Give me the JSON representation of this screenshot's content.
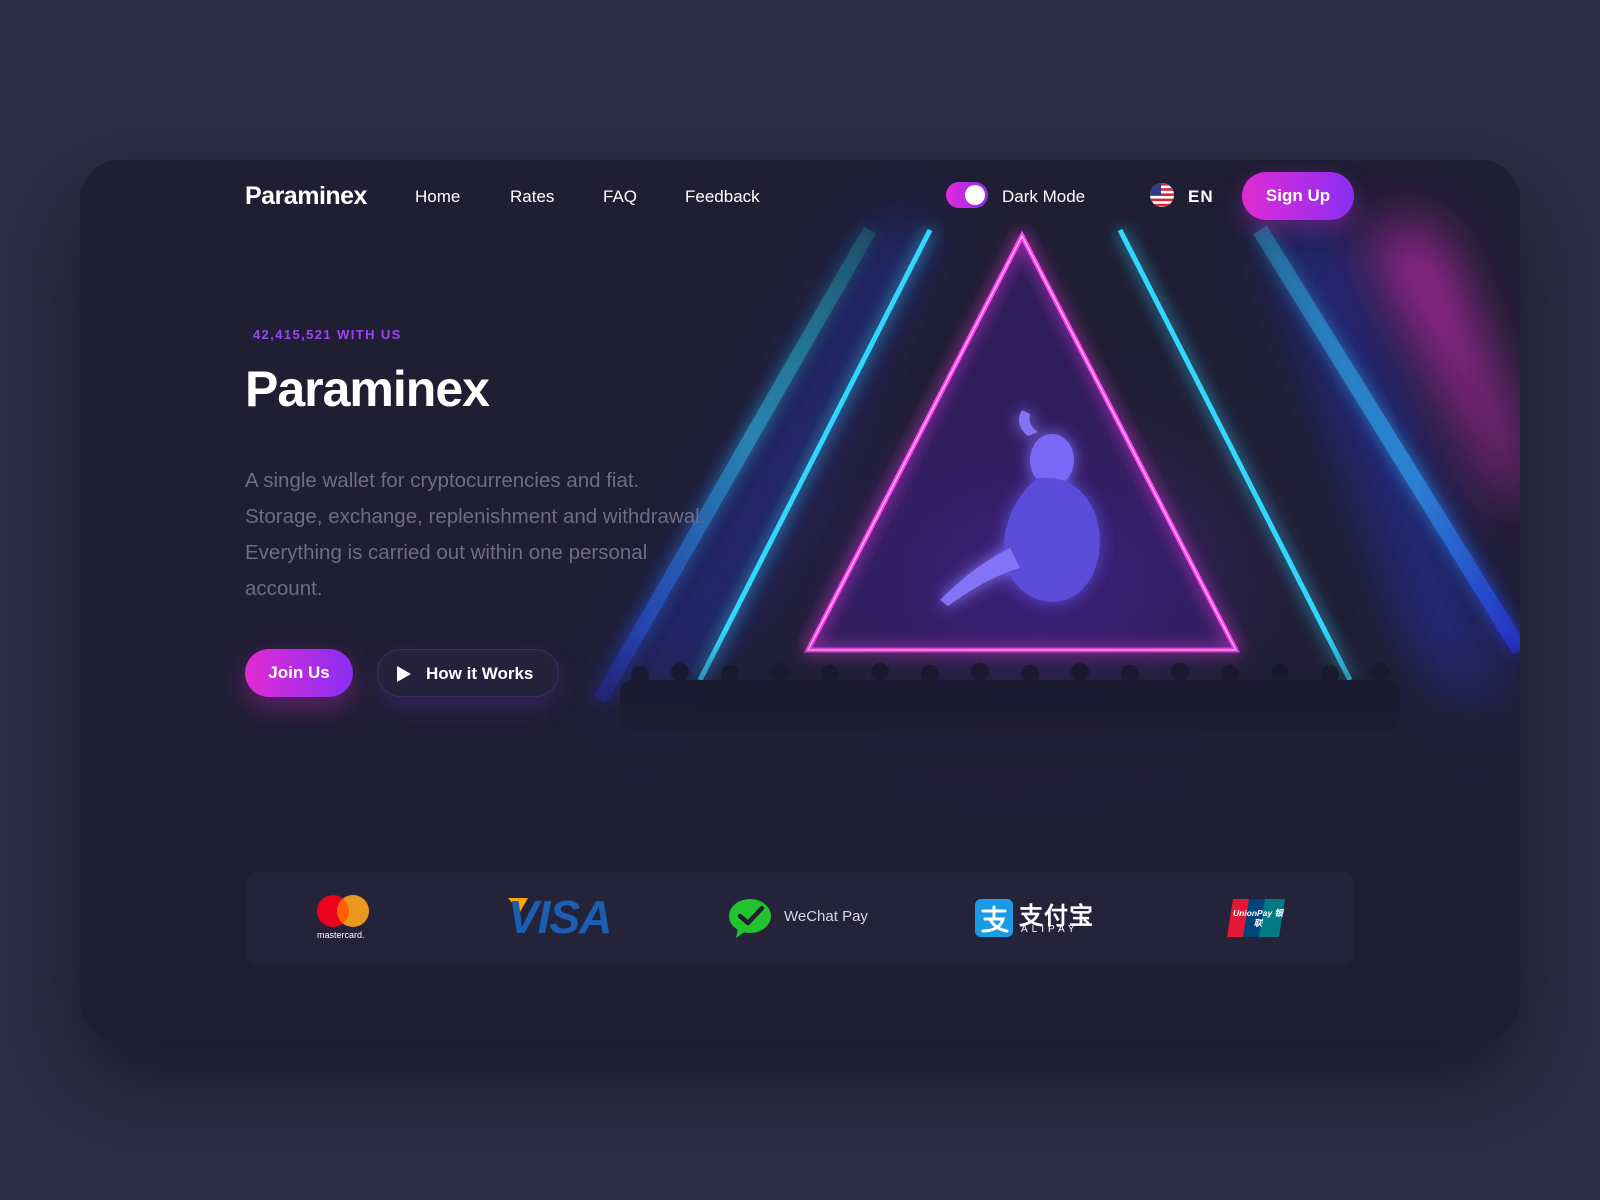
{
  "brand": {
    "logo_text": "Paraminex"
  },
  "nav": {
    "links": [
      "Home",
      "Rates",
      "FAQ",
      "Feedback"
    ],
    "dark_mode_label": "Dark Mode",
    "dark_mode_on": true,
    "language": "EN",
    "signup_label": "Sign Up"
  },
  "hero": {
    "counter": "42,415,521 WITH US",
    "title": "Paraminex",
    "description": "A single wallet for cryptocurrencies and fiat. Storage, exchange, replenishment and withdrawal. Everything is carried out within one personal account.",
    "join_label": "Join Us",
    "how_label": "How it Works"
  },
  "payments": {
    "mastercard_label": "mastercard.",
    "visa_label": "VISA",
    "wechat_label": "WeChat Pay",
    "alipay_cn": "支付宝",
    "alipay_en": "ALIPAY",
    "unionpay_label": "UnionPay 银联"
  },
  "colors": {
    "page_bg": "#2e2d44",
    "card_bg": "#1f1e33",
    "accent_pink": "#e12bd3",
    "accent_purple": "#8a2ef2",
    "neon_cyan": "#2fd3ff",
    "neon_blue": "#3246ff",
    "neon_magenta": "#ff2de0"
  },
  "icons": {
    "play": "play-icon",
    "flag": "us-flag-icon",
    "mastercard": "mastercard-logo",
    "visa": "visa-logo",
    "wechat": "wechat-pay-logo",
    "alipay": "alipay-logo",
    "unionpay": "unionpay-logo"
  }
}
